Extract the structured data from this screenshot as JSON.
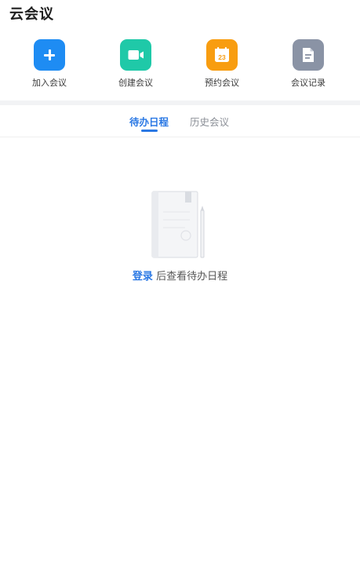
{
  "header": {
    "title": "云会议"
  },
  "actions": [
    {
      "label": "加入会议",
      "icon": "plus-icon",
      "color": "#1e8cf3"
    },
    {
      "label": "创建会议",
      "icon": "video-camera-icon",
      "color": "#1fc9a8"
    },
    {
      "label": "预约会议",
      "icon": "calendar-icon",
      "color": "#f89d10",
      "calendar_day": "23"
    },
    {
      "label": "会议记录",
      "icon": "document-icon",
      "color": "#8a93a5"
    }
  ],
  "tabs": [
    {
      "label": "待办日程",
      "active": true
    },
    {
      "label": "历史会议",
      "active": false
    }
  ],
  "empty_state": {
    "illustration": "notebook-pen-icon",
    "login_link": "登录",
    "message": "后查看待办日程"
  },
  "colors": {
    "accent": "#2a78e4"
  }
}
